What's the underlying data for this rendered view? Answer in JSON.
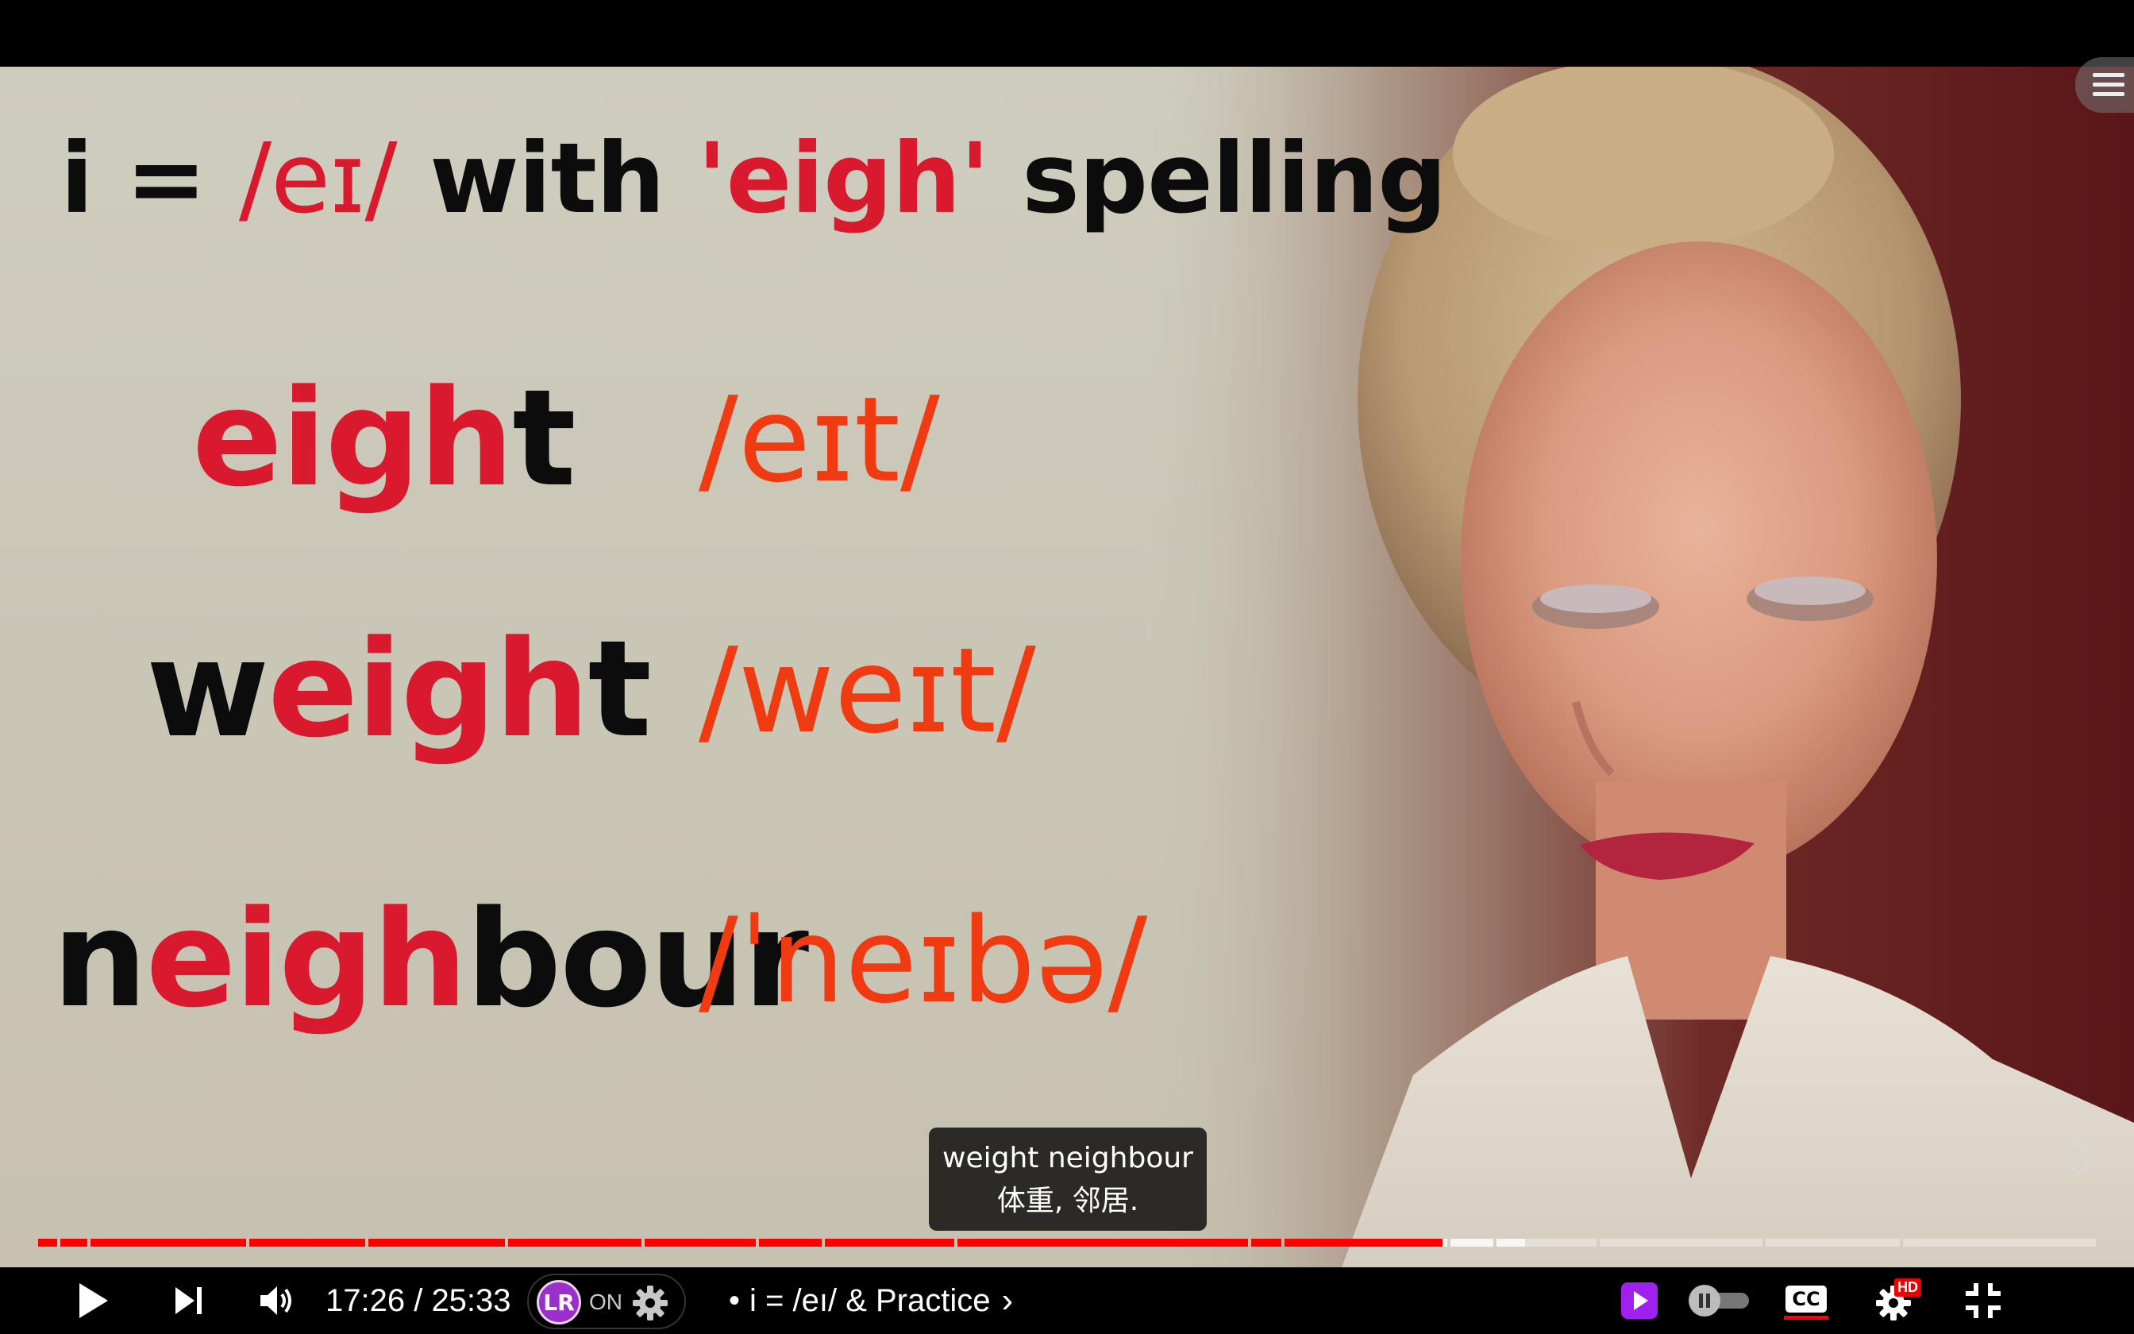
{
  "slide": {
    "title": {
      "part1": "i = ",
      "part2": "/eɪ/",
      "part3": " with ",
      "part4": "'eigh'",
      "part5": " spelling"
    },
    "rows": [
      {
        "word_pre": "",
        "word_red": "eigh",
        "word_post": "t",
        "ipa": "/eɪt/"
      },
      {
        "word_pre": "w",
        "word_red": "eigh",
        "word_post": "t",
        "ipa": "/weɪt/"
      },
      {
        "word_pre": "n",
        "word_red": "eigh",
        "word_post": "bour",
        "ipa": "/ˈneɪbə/"
      }
    ]
  },
  "caption": {
    "line1": "weight neighbour",
    "line2": "体重, 邻居."
  },
  "player": {
    "time": "17:26 / 25:33",
    "chapter_dot": "•",
    "chapter": "i = /eı/ & Practice",
    "chapter_chevron": "›",
    "extension_label": "ON",
    "extension_logo": "LR",
    "hd_badge": "HD",
    "cc_label": "CC",
    "progress_fraction": 0.6824,
    "buffered_fraction": 0.7227
  },
  "colors": {
    "played": "#ff0000",
    "accent_red": "#d8192e",
    "ipa_orange": "#ef3a12",
    "extension_purple": "#9b2fc9"
  },
  "icons": {
    "play": "play-icon",
    "next": "next-icon",
    "volume": "volume-icon",
    "settings": "gear-icon",
    "captions": "cc-icon",
    "fullscreen_exit": "exit-fullscreen-icon",
    "menu": "hamburger-icon",
    "expand": "expand-chevrons-icon"
  }
}
